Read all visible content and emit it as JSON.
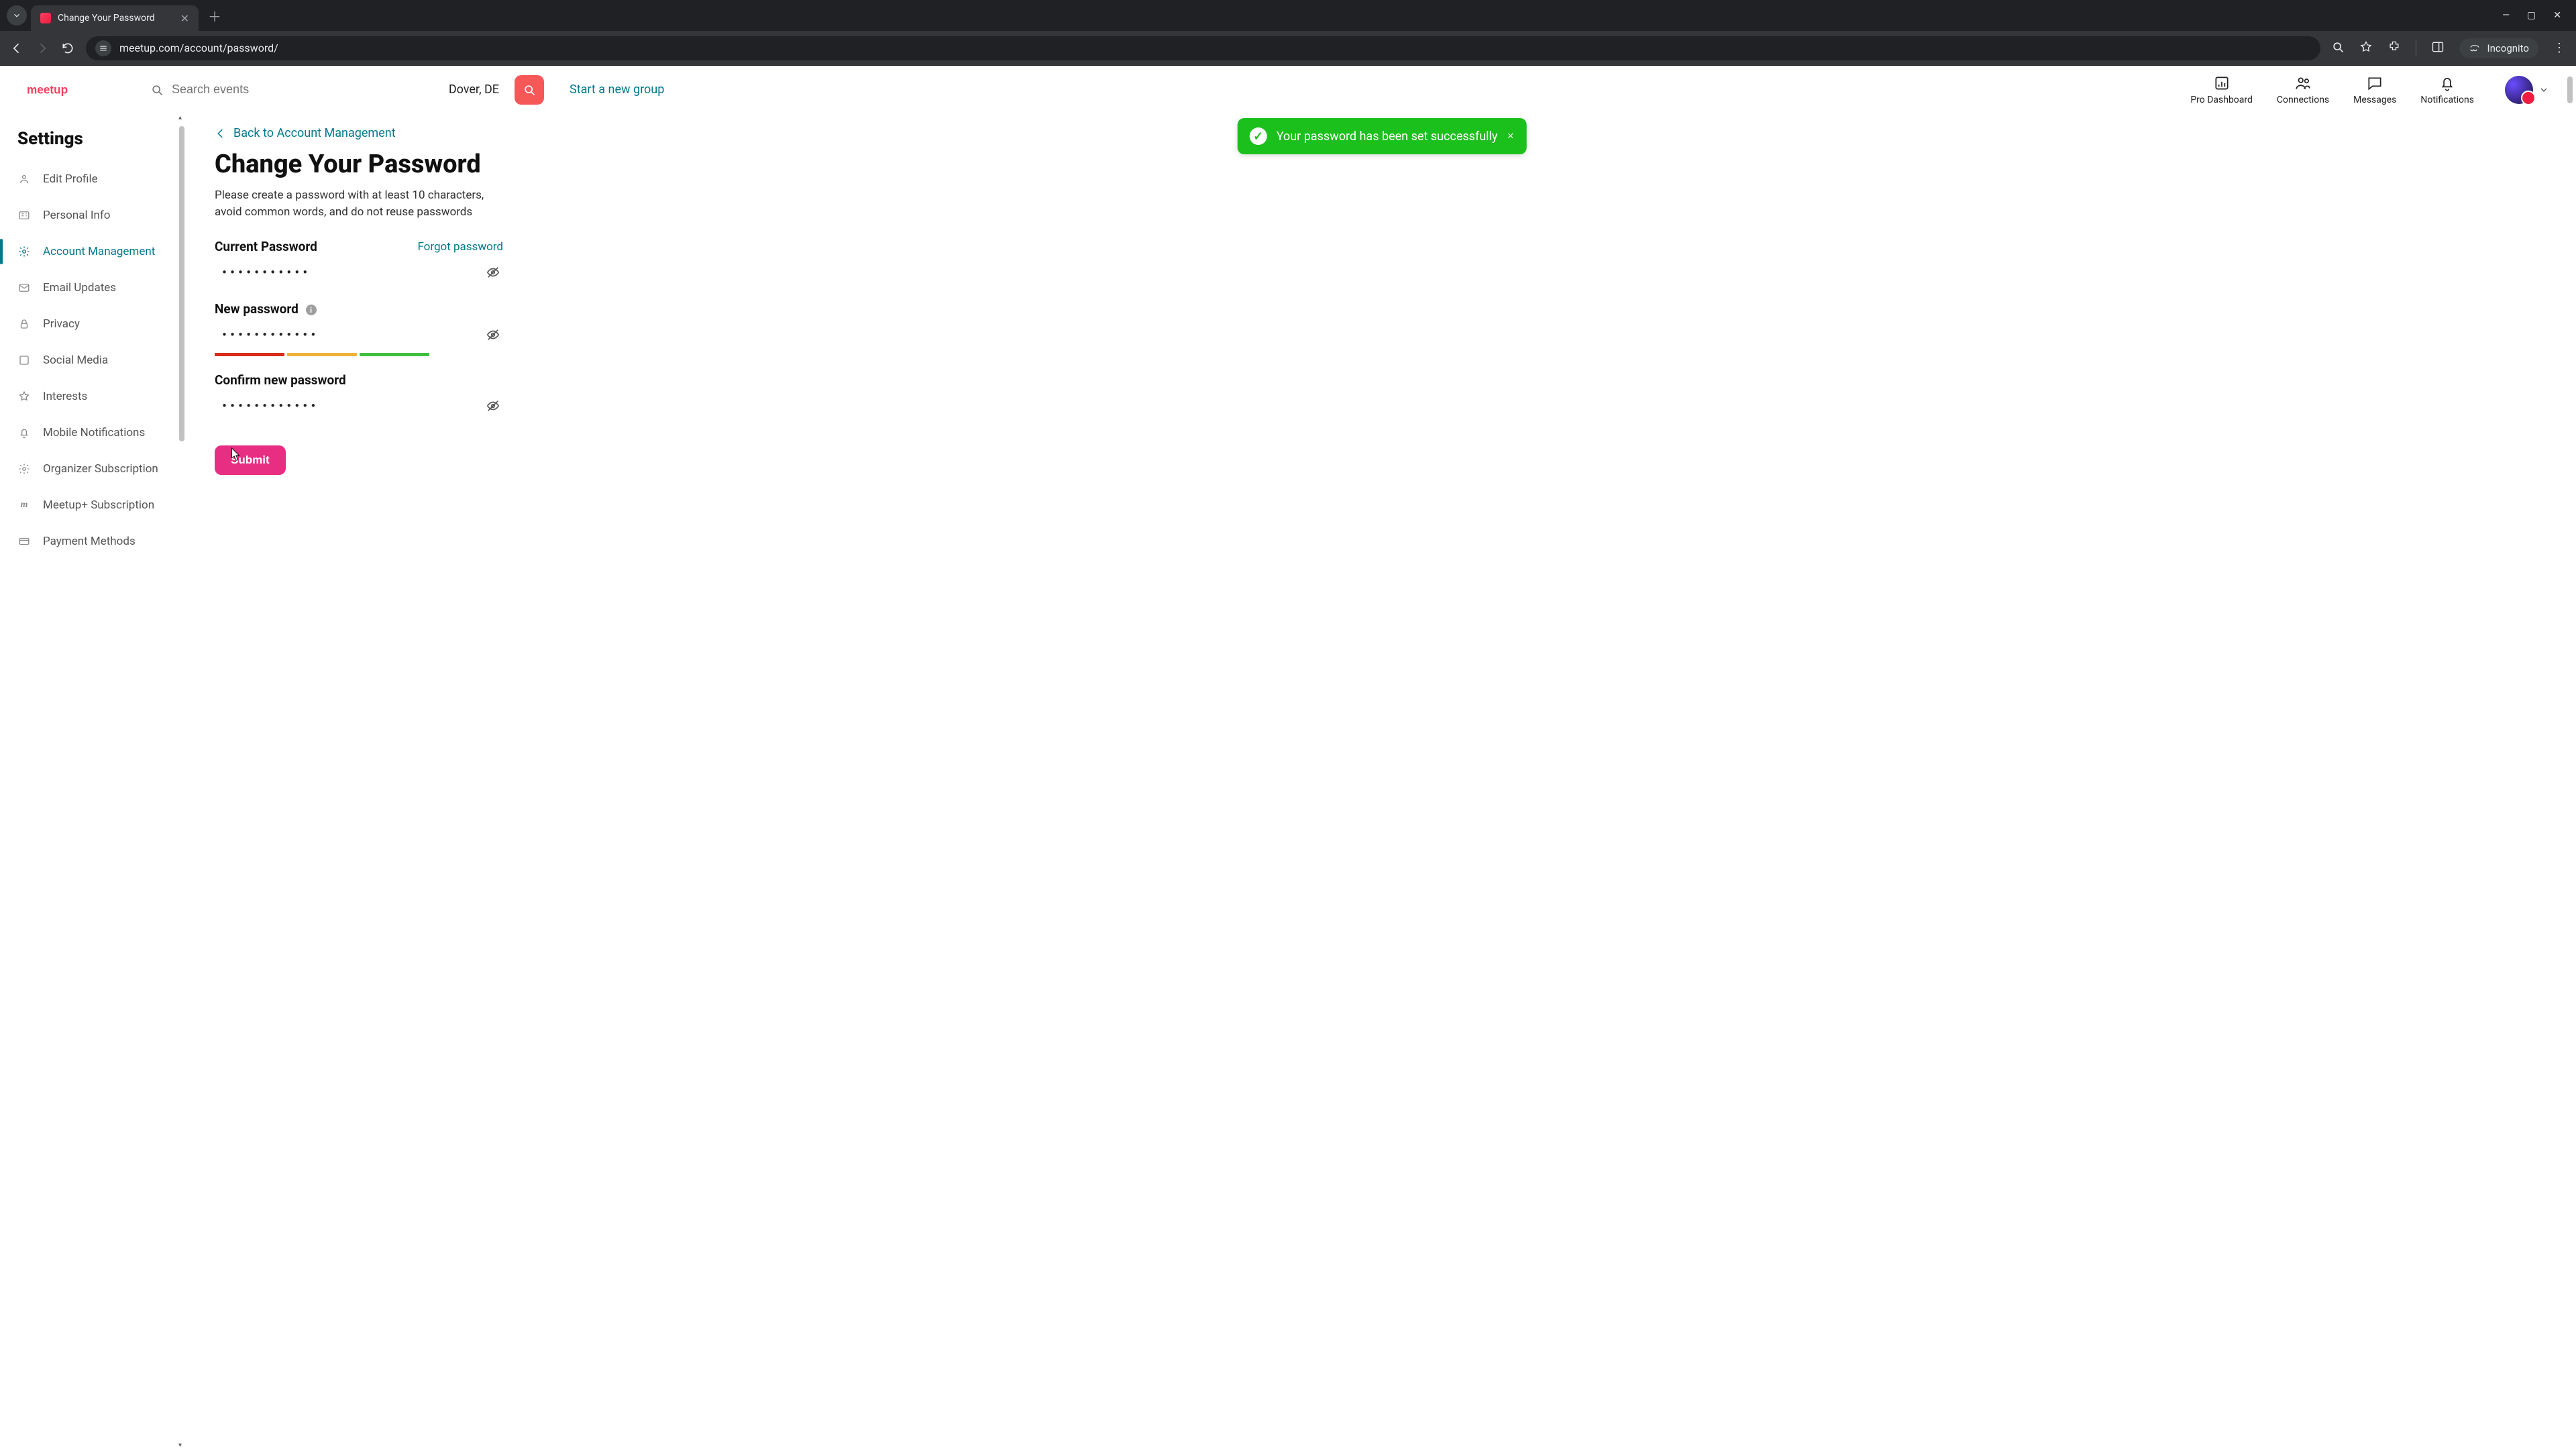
{
  "browser": {
    "tab_title": "Change Your Password",
    "url": "meetup.com/account/password/",
    "incognito_label": "Incognito"
  },
  "header": {
    "search_placeholder": "Search events",
    "location": "Dover, DE",
    "start_group": "Start a new group",
    "nav": {
      "pro": "Pro Dashboard",
      "connections": "Connections",
      "messages": "Messages",
      "notifications": "Notifications"
    }
  },
  "sidebar": {
    "title": "Settings",
    "items": [
      {
        "label": "Edit Profile",
        "icon": "profile-icon"
      },
      {
        "label": "Personal Info",
        "icon": "id-card-icon"
      },
      {
        "label": "Account Management",
        "icon": "gear-icon",
        "active": true
      },
      {
        "label": "Email Updates",
        "icon": "mail-icon"
      },
      {
        "label": "Privacy",
        "icon": "lock-icon"
      },
      {
        "label": "Social Media",
        "icon": "share-icon"
      },
      {
        "label": "Interests",
        "icon": "star-icon"
      },
      {
        "label": "Mobile Notifications",
        "icon": "bell-icon"
      },
      {
        "label": "Organizer Subscription",
        "icon": "gear-icon"
      },
      {
        "label": "Meetup+ Subscription",
        "icon": "mplus-icon"
      },
      {
        "label": "Payment Methods",
        "icon": "card-icon"
      }
    ]
  },
  "main": {
    "back_link": "Back to Account Management",
    "h1": "Change Your Password",
    "description": "Please create a password with at least 10 characters, avoid common words, and do not reuse passwords",
    "current_label": "Current Password",
    "forgot": "Forgot password",
    "new_label": "New password",
    "confirm_label": "Confirm new password",
    "current_value": "•••••••••••",
    "new_value": "••••••••••••",
    "confirm_value": "••••••••••••",
    "strength_colors": [
      "#d92a1c",
      "#f0b13a",
      "#3fbf3f"
    ],
    "submit": "Submit"
  },
  "toast": {
    "message": "Your password has been set successfully"
  }
}
